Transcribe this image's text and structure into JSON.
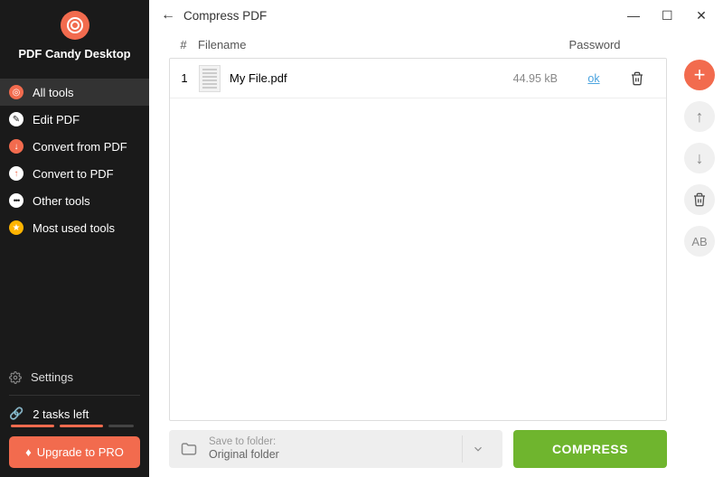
{
  "app": {
    "name": "PDF Candy Desktop"
  },
  "sidebar": {
    "items": [
      {
        "label": "All tools"
      },
      {
        "label": "Edit PDF"
      },
      {
        "label": "Convert from PDF"
      },
      {
        "label": "Convert to PDF"
      },
      {
        "label": "Other tools"
      },
      {
        "label": "Most used tools"
      }
    ],
    "settings_label": "Settings",
    "tasks_label": "2 tasks left",
    "upgrade_label": "Upgrade to PRO"
  },
  "page": {
    "title": "Compress PDF"
  },
  "table": {
    "columns": {
      "num": "#",
      "filename": "Filename",
      "password": "Password"
    },
    "rows": [
      {
        "num": "1",
        "filename": "My File.pdf",
        "size": "44.95 kB",
        "password": "ok"
      }
    ]
  },
  "footer": {
    "save_to_label": "Save to folder:",
    "save_folder": "Original folder",
    "compress_label": "COMPRESS"
  },
  "actions": {
    "rename_label": "AB"
  }
}
